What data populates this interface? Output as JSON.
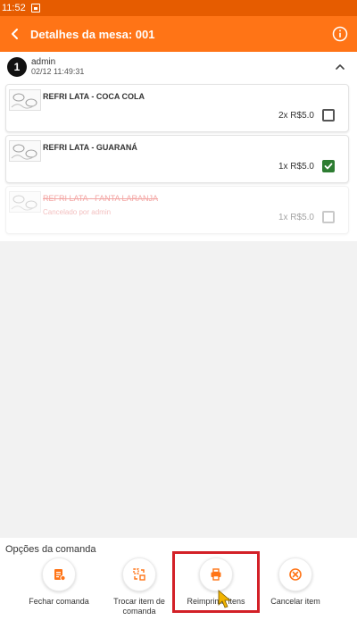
{
  "status_bar": {
    "time": "11:52"
  },
  "app_bar": {
    "title": "Detalhes da mesa: 001"
  },
  "order": {
    "number": "1",
    "user": "admin",
    "datetime": "02/12 11:49:31"
  },
  "items": [
    {
      "name": "REFRI LATA - COCA COLA",
      "quantity_price": "2x R$5.0",
      "checked": false,
      "cancelled": false,
      "note": ""
    },
    {
      "name": "REFRI LATA - GUARANÁ",
      "quantity_price": "1x R$5.0",
      "checked": true,
      "cancelled": false,
      "note": ""
    },
    {
      "name": "REFRI LATA - FANTA LARANJA",
      "quantity_price": "1x R$5.0",
      "checked": false,
      "cancelled": true,
      "note": "Cancelado por admin"
    }
  ],
  "options": {
    "title": "Opções da comanda",
    "buttons": [
      {
        "label": "Fechar comanda",
        "icon": "receipt-icon"
      },
      {
        "label": "Trocar item de comanda",
        "icon": "swap-icon"
      },
      {
        "label": "Reimprimir itens",
        "icon": "printer-icon"
      },
      {
        "label": "Cancelar item",
        "icon": "cancel-circle-icon"
      }
    ]
  },
  "colors": {
    "accent": "#ff7416",
    "status_bar": "#e65c00",
    "checkbox_checked": "#2e7d32",
    "cancelled_text": "#e53935",
    "highlight": "#d32027"
  }
}
